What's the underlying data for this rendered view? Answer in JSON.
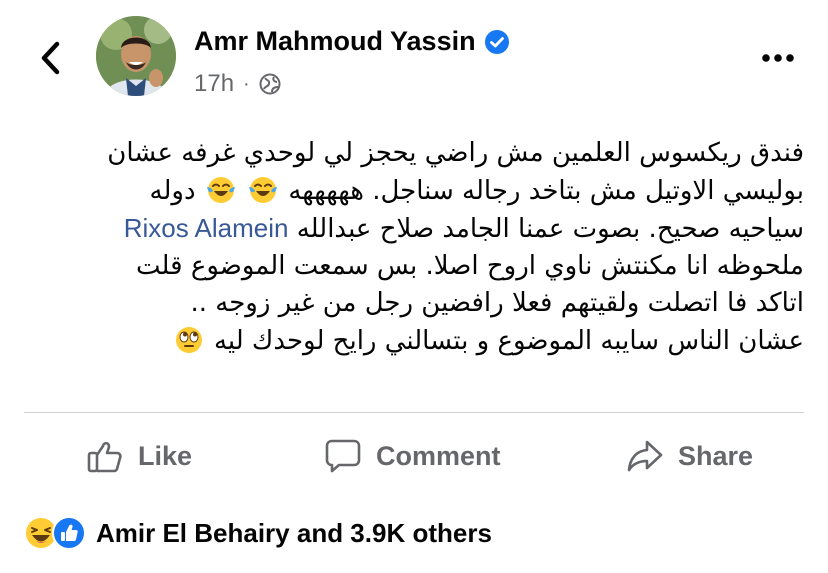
{
  "header": {
    "author_name": "Amr Mahmoud Yassin",
    "timestamp": "17h",
    "separator": "·",
    "privacy_icon": "globe-icon",
    "back_icon": "chevron-left-icon",
    "more_icon": "more-horizontal-icon"
  },
  "post": {
    "lines": [
      "فندق ريكسوس العلمين  مش راضي يحجز لي لوحدي غرفه  عشان",
      "بوليسي الاوتيل مش بتاخد رجاله سناجل. هههههه",
      "دوله",
      "سياحيه  صحيح. بصوت عمنا الجامد  صلاح عبدالله",
      "Rixos Alamein",
      "ملحوظه  انا مكنتش ناوي  اروح اصلا.  بس سمعت الموضوع قلت",
      "اتاكد فا اتصلت  ولقيتهم  فعلا رافضين رجل من غير زوجه  ..",
      "عشان الناس سايبه الموضوع و بتسالني رايح لوحدك ليه"
    ]
  },
  "actions": {
    "like_label": "Like",
    "comment_label": "Comment",
    "share_label": "Share"
  },
  "reactions": {
    "summary": "Amir El Behairy and 3.9K others"
  },
  "colors": {
    "accent": "#1877f2",
    "mention": "#385898",
    "secondary_text": "#65676b",
    "divider": "#ced0d4"
  }
}
